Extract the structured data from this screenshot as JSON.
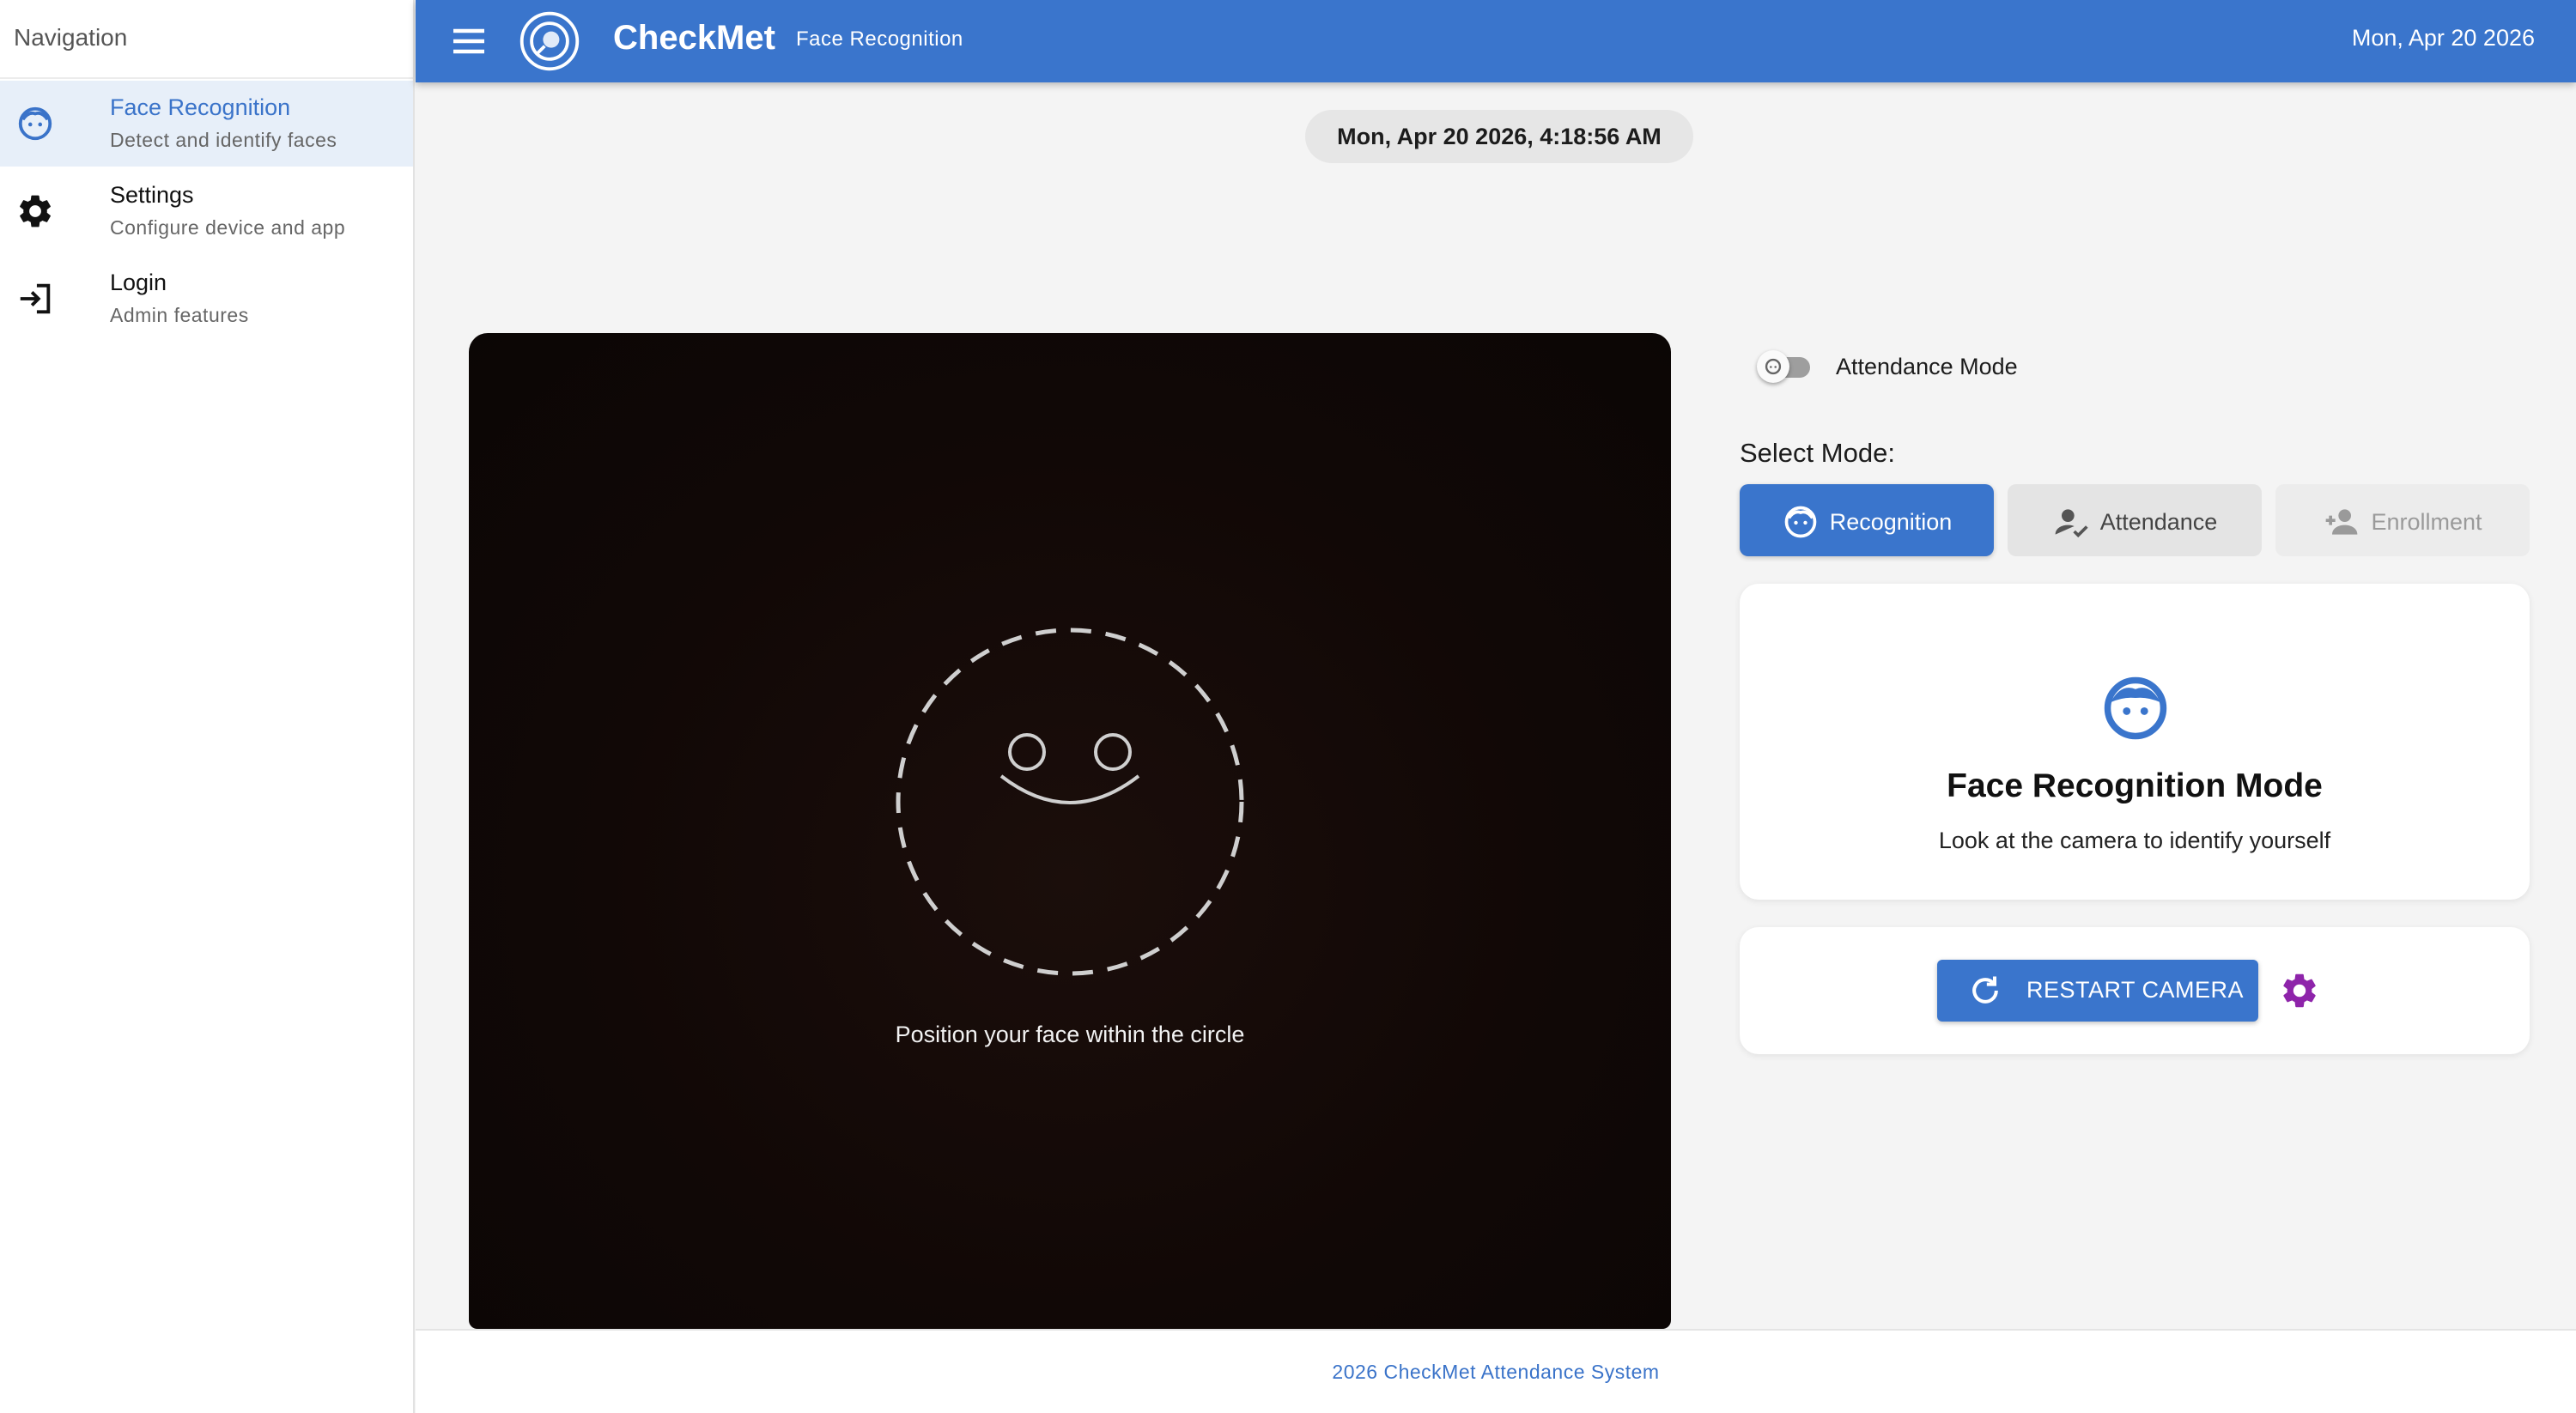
{
  "sidebar": {
    "title": "Navigation",
    "items": [
      {
        "label": "Face Recognition",
        "sub": "Detect and identify faces",
        "icon": "face-icon",
        "active": true
      },
      {
        "label": "Settings",
        "sub": "Configure device and app",
        "icon": "gear-icon",
        "active": false
      },
      {
        "label": "Login",
        "sub": "Admin features",
        "icon": "login-icon",
        "active": false
      }
    ]
  },
  "header": {
    "brand": "CheckMet",
    "subtitle": "Face Recognition",
    "date": "Mon, Apr 20 2026"
  },
  "clock": "Mon, Apr 20 2026, 4:18:56 AM",
  "camera": {
    "hint": "Position your face within the circle"
  },
  "attendance_toggle": {
    "label": "Attendance Mode",
    "on": false
  },
  "mode": {
    "label": "Select Mode:",
    "options": [
      {
        "label": "Recognition",
        "icon": "face-icon",
        "selected": true
      },
      {
        "label": "Attendance",
        "icon": "person-check-icon",
        "selected": false
      },
      {
        "label": "Enrollment",
        "icon": "person-add-icon",
        "selected": false,
        "disabled": true
      }
    ]
  },
  "info_card": {
    "title": "Face Recognition Mode",
    "description": "Look at the camera to identify yourself"
  },
  "actions": {
    "restart_label": "RESTART CAMERA"
  },
  "footer": {
    "text": "2026 CheckMet Attendance System"
  },
  "colors": {
    "primary": "#3a75cc",
    "accent_purple": "#8e24aa",
    "sidebar_active": "#e7eff9"
  }
}
